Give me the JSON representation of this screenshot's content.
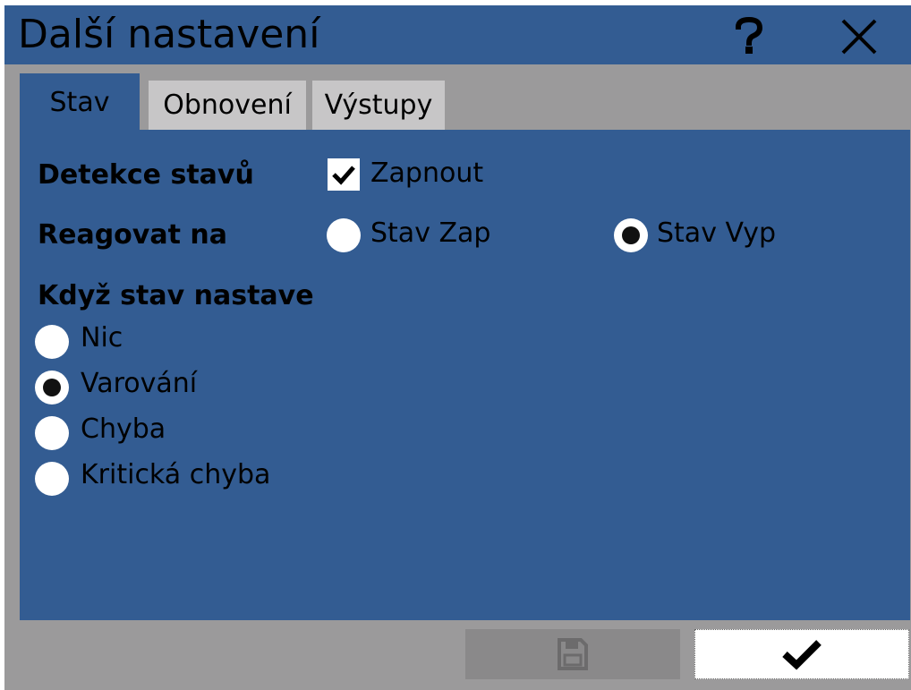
{
  "dialog": {
    "title": "Další nastavení",
    "help_icon": "question-icon",
    "close_icon": "close-icon"
  },
  "tabs": [
    {
      "label": "Stav",
      "active": true
    },
    {
      "label": "Obnovení",
      "active": false
    },
    {
      "label": "Výstupy",
      "active": false
    }
  ],
  "state_detection": {
    "label": "Detekce stavů",
    "checkbox_label": "Zapnout",
    "checked": true
  },
  "react_on": {
    "label": "Reagovat na",
    "options": [
      {
        "label": "Stav Zap",
        "selected": false
      },
      {
        "label": "Stav Vyp",
        "selected": true
      }
    ]
  },
  "when_state": {
    "label": "Když stav nastave",
    "options": [
      {
        "label": "Nic",
        "selected": false
      },
      {
        "label": "Varování",
        "selected": true
      },
      {
        "label": "Chyba",
        "selected": false
      },
      {
        "label": "Kritická chyba",
        "selected": false
      }
    ]
  },
  "footer": {
    "save_icon": "save-icon",
    "confirm_icon": "checkmark-icon"
  },
  "colors": {
    "panel": "#335c92",
    "window": "#9b9a9b",
    "inactive_tab": "#c7c6c7"
  }
}
